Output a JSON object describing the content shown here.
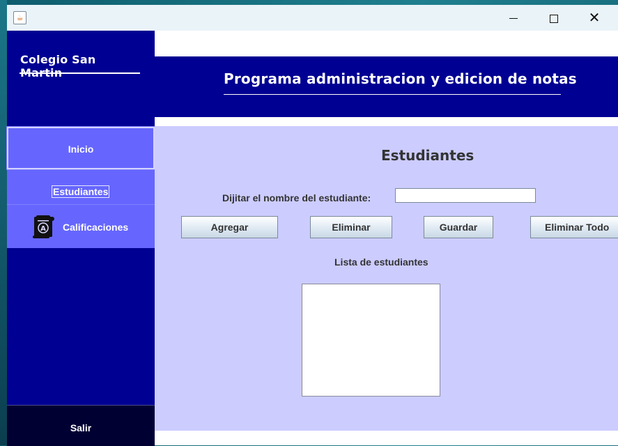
{
  "window": {
    "minimize_glyph": "—",
    "maximize_glyph": "☐",
    "close_glyph": "✕"
  },
  "sidebar": {
    "brand": "Colegio San Martin",
    "items": [
      {
        "label": "Inicio"
      },
      {
        "label": "Estudiantes"
      },
      {
        "label": "Calificaciones",
        "icon": "grade-scroll-icon"
      }
    ],
    "exit_label": "Salir"
  },
  "header": {
    "title": "Programa administracion y edicion de notas"
  },
  "main": {
    "section_title": "Estudiantes",
    "prompt_label": "Dijitar el nombre del estudiante:",
    "name_input_value": "",
    "buttons": {
      "add": "Agregar",
      "delete": "Eliminar",
      "save": "Guardar",
      "delete_all": "Eliminar Todo"
    },
    "list_label": "Lista de estudiantes",
    "students": []
  },
  "colors": {
    "sidebar_bg": "#000092",
    "nav_item_bg": "#6666ff",
    "exit_bg": "#000033",
    "panel_bg": "#ccccff",
    "header_bg": "#000092"
  }
}
